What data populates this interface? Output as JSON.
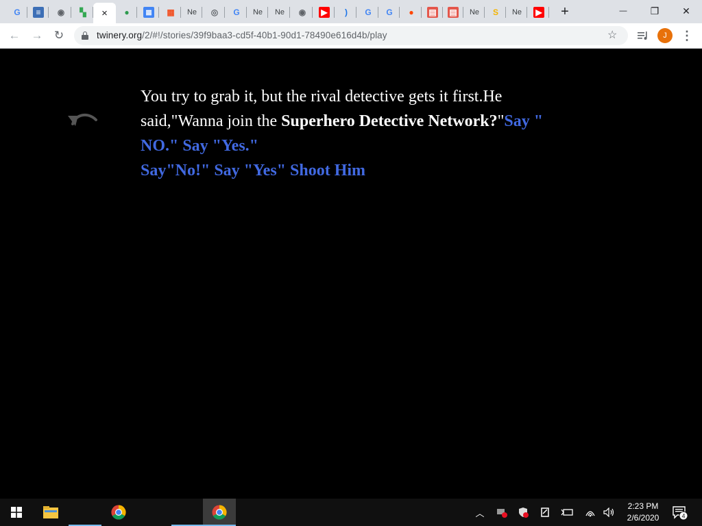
{
  "browser": {
    "tabs": [
      {
        "text": "G",
        "color": "#4285f4",
        "bg": "transparent"
      },
      {
        "text": "≡",
        "color": "#ffffff",
        "bg": "#3d6fb6"
      },
      {
        "text": "◉",
        "color": "#5f6368",
        "bg": "transparent"
      },
      {
        "text": "▚",
        "color": "#34a853",
        "bg": "transparent"
      },
      {
        "text": "",
        "color": "",
        "bg": ""
      },
      {
        "text": "●",
        "color": "#2e9b4e",
        "bg": "transparent"
      },
      {
        "text": "≣",
        "color": "#ffffff",
        "bg": "#4285f4"
      },
      {
        "text": "▦",
        "color": "#f25022",
        "bg": "transparent"
      },
      {
        "text": "Ne",
        "color": "#3c4043",
        "bg": "transparent"
      },
      {
        "text": "◎",
        "color": "#5f6368",
        "bg": "transparent"
      },
      {
        "text": "G",
        "color": "#4285f4",
        "bg": "transparent"
      },
      {
        "text": "Ne",
        "color": "#3c4043",
        "bg": "transparent"
      },
      {
        "text": "Ne",
        "color": "#3c4043",
        "bg": "transparent"
      },
      {
        "text": "◉",
        "color": "#5f6368",
        "bg": "transparent"
      },
      {
        "text": "▶",
        "color": "#ffffff",
        "bg": "#ff0000"
      },
      {
        "text": ")",
        "color": "#1a73e8",
        "bg": "transparent"
      },
      {
        "text": "G",
        "color": "#4285f4",
        "bg": "transparent"
      },
      {
        "text": "G",
        "color": "#4285f4",
        "bg": "transparent"
      },
      {
        "text": "●",
        "color": "#ff4500",
        "bg": "transparent"
      },
      {
        "text": "▤",
        "color": "#ffffff",
        "bg": "#e4574c"
      },
      {
        "text": "▤",
        "color": "#ffffff",
        "bg": "#e4574c"
      },
      {
        "text": "Ne",
        "color": "#3c4043",
        "bg": "transparent"
      },
      {
        "text": "S",
        "color": "#f4b400",
        "bg": "transparent"
      },
      {
        "text": "Ne",
        "color": "#3c4043",
        "bg": "transparent"
      },
      {
        "text": "▶",
        "color": "#ffffff",
        "bg": "#ff0000"
      }
    ],
    "active_tab_close": "×",
    "new_tab": "+",
    "window_controls": {
      "minimize": "—",
      "restore": "❐",
      "close": "✕"
    },
    "nav": {
      "back": "←",
      "forward": "→",
      "reload": "↻"
    },
    "url_host": "twinery.org",
    "url_path": "/2/#!/stories/39f9baa3-cd5f-40b1-90d1-78490e616d4b/play",
    "bookmark_star": "☆",
    "avatar_letter": "J",
    "menu": "⋮",
    "avatar_color": "#e8710a"
  },
  "story": {
    "intro": "You try to grab it, but the rival detective gets it first.He said,\"Wanna join the ",
    "network_bold": "Superhero Detective Network?",
    "after_bold": "\"",
    "links": [
      "Say \" NO.\"",
      "Say \"Yes.\"",
      "Say\"No!\"",
      "Say \"Yes\"",
      "Shoot Him"
    ],
    "link_color": "#4169e1"
  },
  "taskbar": {
    "time": "2:23 PM",
    "date": "2/6/2020",
    "notification_count": "4"
  }
}
